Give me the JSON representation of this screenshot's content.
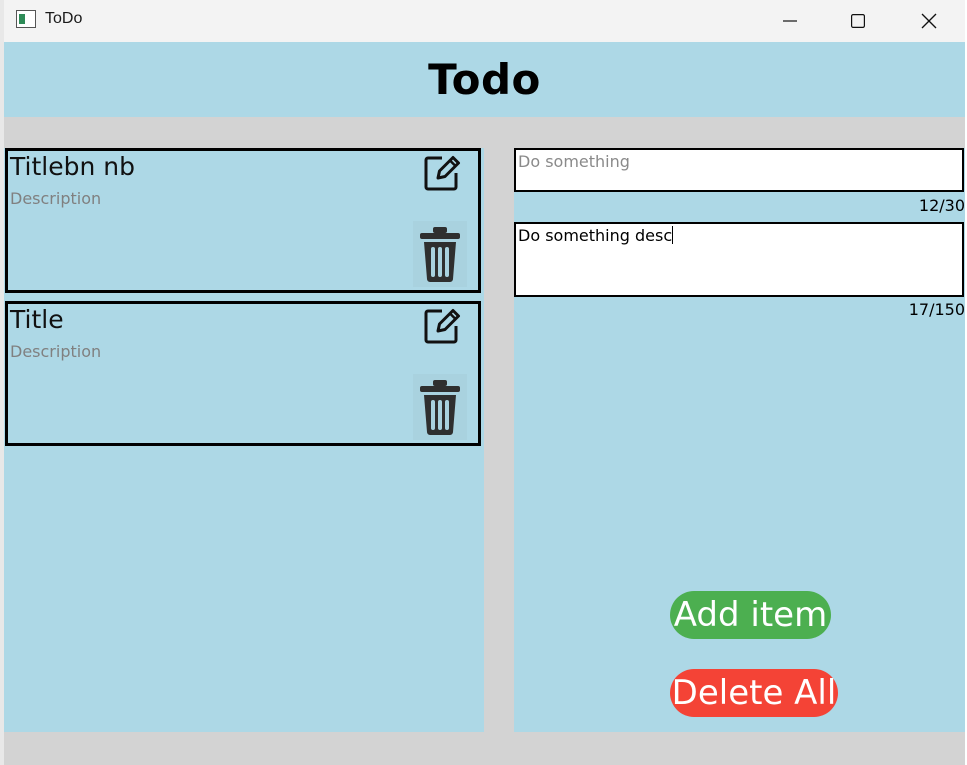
{
  "window": {
    "title": "ToDo"
  },
  "header": {
    "title": "Todo"
  },
  "todos": [
    {
      "title": "Titlebn nb",
      "description": "Description"
    },
    {
      "title": "Title",
      "description": "Description"
    }
  ],
  "form": {
    "title_value": "Do something",
    "title_counter": "12/30",
    "description_value": "Do something desc",
    "description_counter": "17/150"
  },
  "buttons": {
    "add_label": "Add item",
    "delete_all_label": "Delete All"
  },
  "colors": {
    "panel": "#add8e6",
    "add": "#4caf50",
    "delete_all": "#f44336"
  }
}
